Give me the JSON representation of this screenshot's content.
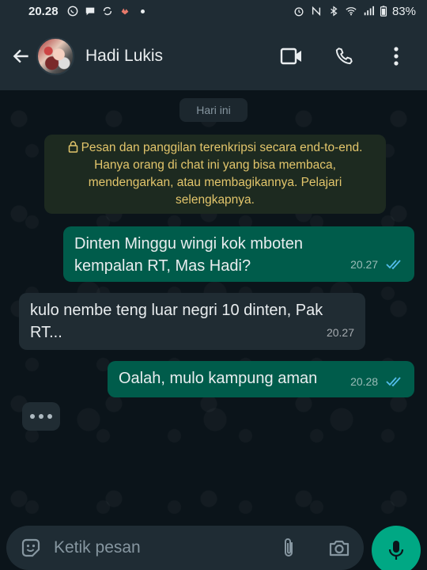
{
  "status_bar": {
    "time": "20.28",
    "battery": "83%"
  },
  "header": {
    "contact_name": "Hadi Lukis",
    "icons": [
      "back-arrow-icon",
      "video-call-icon",
      "phone-icon",
      "more-vert-icon"
    ]
  },
  "chat": {
    "date_label": "Hari ini",
    "encryption_notice": "Pesan dan panggilan terenkripsi secara end-to-end. Hanya orang di chat ini yang bisa membaca, mendengarkan, atau membagikannya. Pelajari selengkapnya.",
    "messages": [
      {
        "direction": "outgoing",
        "text": "Dinten Minggu wingi kok mboten kempalan RT, Mas Hadi?",
        "time": "20.27",
        "status": "read"
      },
      {
        "direction": "incoming",
        "text": "kulo nembe teng luar negri 10 dinten, Pak RT...",
        "time": "20.27"
      },
      {
        "direction": "outgoing",
        "text": "Oalah, mulo kampung aman",
        "time": "20.28",
        "status": "read"
      }
    ]
  },
  "composer": {
    "placeholder": "Ketik pesan"
  },
  "colors": {
    "header_bg": "#1f2c34",
    "outgoing_bubble": "#005c4b",
    "incoming_bubble": "#202c33",
    "read_ticks": "#53bdeb",
    "notice_text": "#e2c56b",
    "mic_button": "#00a884"
  }
}
